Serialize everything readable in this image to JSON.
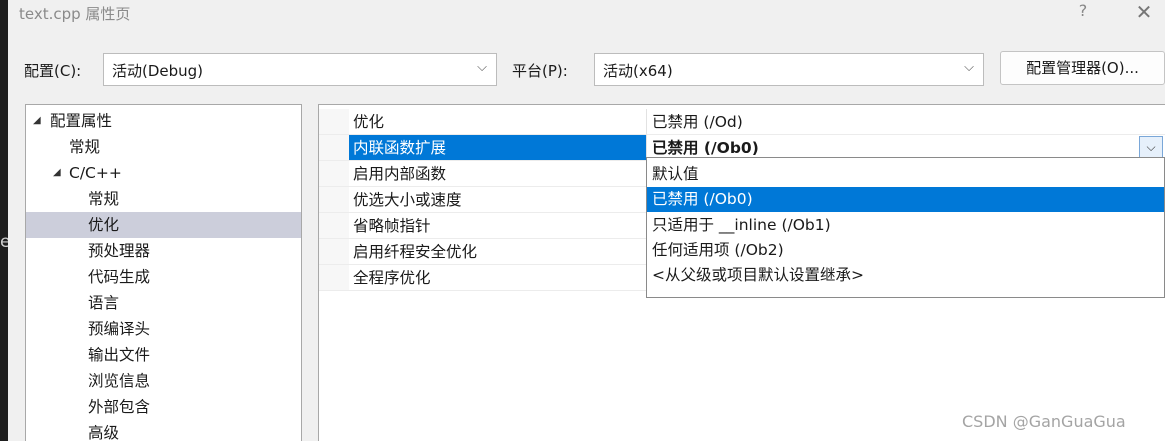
{
  "window": {
    "title": "text.cpp 属性页",
    "help_label": "?",
    "close_label": "✕"
  },
  "toolbar": {
    "config_label": "配置(C):",
    "config_value": "活动(Debug)",
    "platform_label": "平台(P):",
    "platform_value": "活动(x64)",
    "config_manager_label": "配置管理器(O)...",
    "chevron": "⌵"
  },
  "tree": {
    "items": [
      {
        "label": "配置属性",
        "arrow": "◢",
        "level": 0
      },
      {
        "label": "常规",
        "level": 1
      },
      {
        "label": "C/C++",
        "arrow": "◢",
        "level": 1
      },
      {
        "label": "常规",
        "level": 2
      },
      {
        "label": "优化",
        "level": 2,
        "selected": true
      },
      {
        "label": "预处理器",
        "level": 2
      },
      {
        "label": "代码生成",
        "level": 2
      },
      {
        "label": "语言",
        "level": 2
      },
      {
        "label": "预编译头",
        "level": 2
      },
      {
        "label": "输出文件",
        "level": 2
      },
      {
        "label": "浏览信息",
        "level": 2
      },
      {
        "label": "外部包含",
        "level": 2
      },
      {
        "label": "高级",
        "level": 2
      }
    ]
  },
  "grid": {
    "rows": [
      {
        "name": "优化",
        "value": "已禁用 (/Od)"
      },
      {
        "name": "内联函数扩展",
        "value": "已禁用 (/Ob0)",
        "selected": true
      },
      {
        "name": "启用内部函数",
        "value": ""
      },
      {
        "name": "优选大小或速度",
        "value": ""
      },
      {
        "name": "省略帧指针",
        "value": ""
      },
      {
        "name": "启用纤程安全优化",
        "value": ""
      },
      {
        "name": "全程序优化",
        "value": ""
      }
    ],
    "dropdown_button": "⌵"
  },
  "dropdown": {
    "options": [
      {
        "label": "默认值"
      },
      {
        "label": "已禁用 (/Ob0)",
        "selected": true
      },
      {
        "label": "只适用于 __inline (/Ob1)"
      },
      {
        "label": "任何适用项 (/Ob2)"
      },
      {
        "label": "<从父级或项目默认设置继承>"
      }
    ]
  },
  "watermark": "CSDN @GanGuaGua",
  "background_edge_text": "e",
  "colors": {
    "selection": "#0078d7",
    "tree_selection": "#cccedb",
    "dialog_bg": "#f0f0f0"
  }
}
